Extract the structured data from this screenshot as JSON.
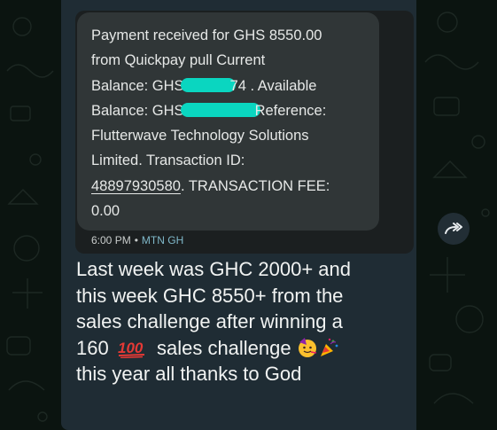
{
  "theme": {
    "chat_background": "#0b1410",
    "bubble_color": "#1f2c34",
    "sms_card_color": "#303637",
    "redaction_color": "#0ad6c0",
    "text_color": "#f1f3f2"
  },
  "sms": {
    "line1": "Payment received for GHS 8550.00",
    "line2": "from Quickpay pull  Current",
    "line3_a": "Balance: GHS",
    "line3_b": "74 . Available",
    "line4_a": "Balance: GHS",
    "line4_b": "Reference:",
    "line5": "Flutterwave Technology Solutions",
    "line6": "Limited. Transaction ID:",
    "line7_link": "48897930580",
    "line7_rest": ". TRANSACTION FEE:",
    "line8": "0.00",
    "time": "6:00 PM",
    "separator": "•",
    "sim_label": "MTN GH"
  },
  "caption": {
    "line1": "Last week was GHC 2000+ and",
    "line2": "this week GHC 8550+ from the",
    "line3": "sales challenge after winning a",
    "line4_a": "160",
    "line4_b": "sales challenge",
    "line5": "this year all thanks to God"
  },
  "icons": {
    "forward": "forward-arrow-icon",
    "hundred": "hundred-points-emoji",
    "party_face": "partying-face-emoji",
    "party_popper": "party-popper-emoji"
  }
}
